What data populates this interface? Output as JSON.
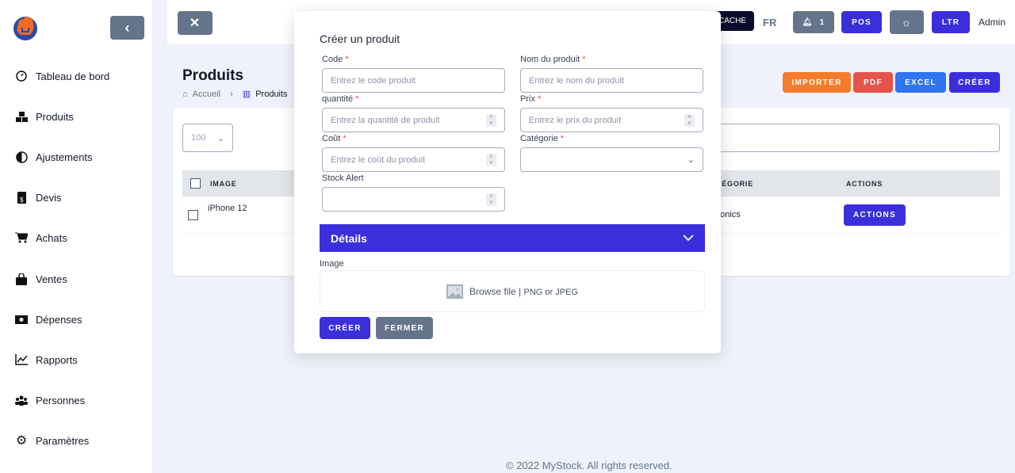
{
  "sidebar": {
    "items": [
      {
        "label": "Tableau de bord",
        "icon": "dashboard-gauge-icon"
      },
      {
        "label": "Produits",
        "icon": "boxes-icon"
      },
      {
        "label": "Ajustements",
        "icon": "half-circle-icon"
      },
      {
        "label": "Devis",
        "icon": "invoice-dollar-icon"
      },
      {
        "label": "Achats",
        "icon": "cart-icon"
      },
      {
        "label": "Ventes",
        "icon": "shopping-bag-icon"
      },
      {
        "label": "Dépenses",
        "icon": "money-bill-icon"
      },
      {
        "label": "Rapports",
        "icon": "line-chart-icon"
      },
      {
        "label": "Personnes",
        "icon": "users-icon"
      },
      {
        "label": "Paramètres",
        "icon": "gear-icon"
      }
    ]
  },
  "header": {
    "cache_label": "CACHE",
    "lang": "FR",
    "notif_count": "1",
    "pos_label": "POS",
    "dir_label": "LTR",
    "user": "Admin"
  },
  "page": {
    "title": "Produits",
    "breadcrumb": [
      "Accueil",
      "Produits"
    ],
    "actions": {
      "import": "IMPORTER",
      "pdf": "PDF",
      "excel": "EXCEL",
      "create": "CRÉER"
    }
  },
  "table": {
    "per_page": "100",
    "headers": [
      "IMAGE",
      "CATÉGORIE",
      "ACTIONS"
    ],
    "rows": [
      {
        "name": "iPhone 12",
        "category": "Electronics",
        "action": "ACTIONS"
      }
    ]
  },
  "modal": {
    "title": "Créer un produit",
    "fields": {
      "code": {
        "label": "Code",
        "placeholder": "Entrez le code produit"
      },
      "name": {
        "label": "Nom du produit",
        "placeholder": "Entrez le nom du produit"
      },
      "qty": {
        "label": "quantité",
        "placeholder": "Entrez la quantité de produit"
      },
      "price": {
        "label": "Prix",
        "placeholder": "Entrez le prix du produit"
      },
      "cost": {
        "label": "Coût",
        "placeholder": "Entrez le coût du produit"
      },
      "category": {
        "label": "Catégorie",
        "value": ""
      },
      "stock": {
        "label": "Stock Alert",
        "placeholder": ""
      }
    },
    "required_mark": "*",
    "details_label": "Détails",
    "image_label": "Image",
    "browse": "Browse file",
    "formats": "PNG or JPEG",
    "create": "CRÉER",
    "close": "FERMER"
  },
  "footer": "© 2022 MyStock. All rights reserved.",
  "colors": {
    "primary": "#3b2fdc",
    "slate": "#64748b",
    "orange": "#f47c2a",
    "red": "#e5534b",
    "blue": "#2f74f0"
  }
}
